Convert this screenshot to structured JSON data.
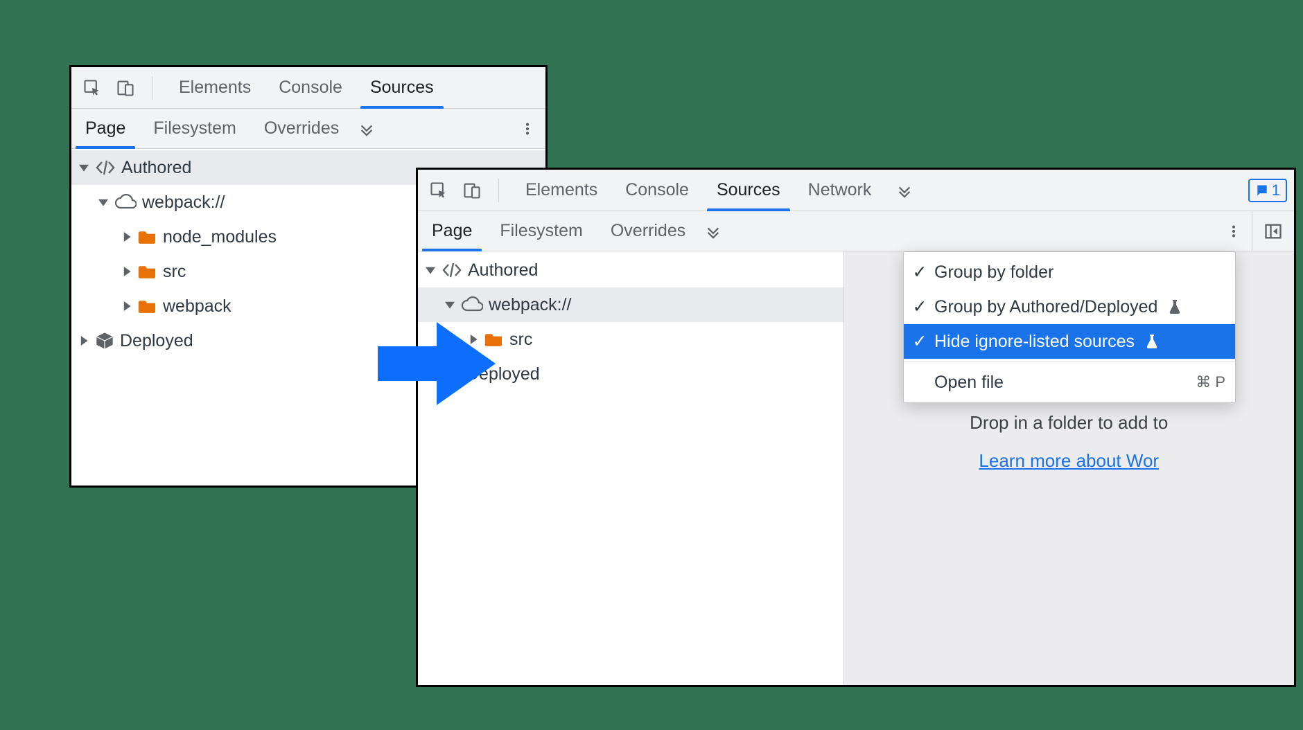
{
  "left_window": {
    "main_tabs": [
      "Elements",
      "Console",
      "Sources"
    ],
    "main_active_index": 2,
    "sub_tabs": [
      "Page",
      "Filesystem",
      "Overrides"
    ],
    "sub_active_index": 0,
    "tree": {
      "authored_label": "Authored",
      "webpack_label": "webpack://",
      "folders": [
        "node_modules",
        "src",
        "webpack"
      ],
      "deployed_label": "Deployed"
    }
  },
  "right_window": {
    "main_tabs": [
      "Elements",
      "Console",
      "Sources",
      "Network"
    ],
    "main_active_index": 2,
    "badge_count": "1",
    "sub_tabs": [
      "Page",
      "Filesystem",
      "Overrides"
    ],
    "sub_active_index": 0,
    "tree": {
      "authored_label": "Authored",
      "webpack_label": "webpack://",
      "folders": [
        "src"
      ],
      "deployed_label": "Deployed"
    },
    "menu": {
      "items": [
        {
          "checked": true,
          "label": "Group by folder",
          "flask": false
        },
        {
          "checked": true,
          "label": "Group by Authored/Deployed",
          "flask": true
        },
        {
          "checked": true,
          "label": "Hide ignore-listed sources",
          "flask": true,
          "highlight": true
        }
      ],
      "open_file_label": "Open file",
      "open_file_shortcut": "⌘ P"
    },
    "side": {
      "drop_text": "Drop in a folder to add to",
      "learn_text": "Learn more about Wor"
    }
  }
}
